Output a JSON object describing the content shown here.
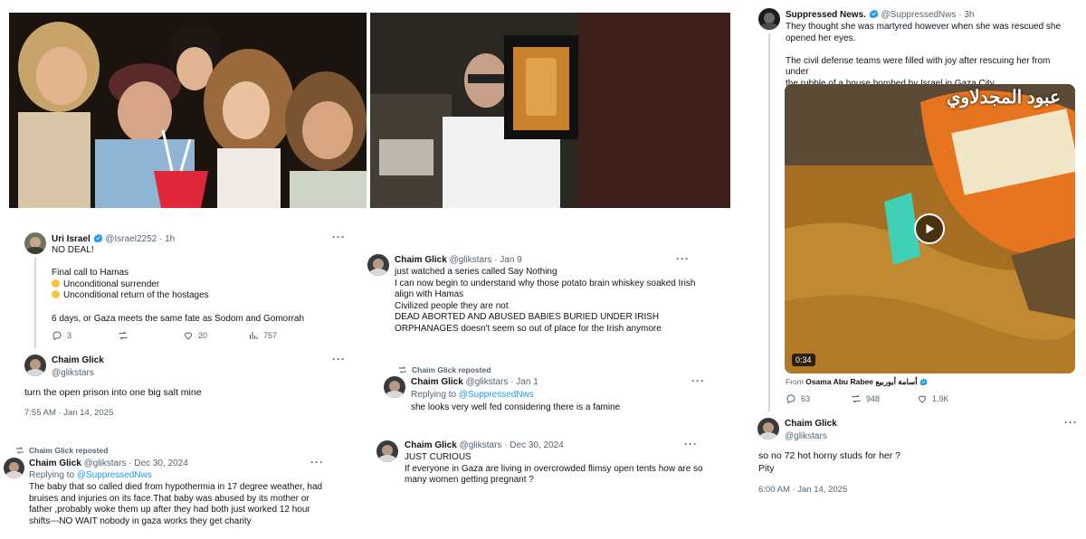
{
  "tweet_uri": {
    "name": "Uri Israel",
    "handle": "@Israel2252",
    "time": "· 1h",
    "line1": "NO DEAL!",
    "line2": "Final call to Hamas",
    "bullet1": "Unconditional surrender",
    "bullet2": "Unconditional return of the hostages",
    "line3": "6 days, or Gaza meets the same fate as Sodom and Gomorrah",
    "replies": "3",
    "likes": "20",
    "views": "757"
  },
  "reply_left": {
    "name": "Chaim Glick",
    "handle": "@glikstars",
    "text": "turn the open prison into one big salt mine",
    "timestamp": "7:55 AM · Jan 14, 2025"
  },
  "repost_left": {
    "reposted_label": "Chaim Glick reposted",
    "name": "Chaim Glick",
    "handle": "@glikstars",
    "time": "· Dec 30, 2024",
    "replying_prefix": "Replying to ",
    "replying_to": "@SuppressedNws",
    "text_lines": [
      "The baby that so called died from hypothermia in 17 degree weather, had",
      "bruises and injuries on its face.That baby was abused by its mother or",
      "father ,probably woke them up after they had both just worked 12 hour",
      "shifts---NO WAIT nobody in gaza works they get charity"
    ]
  },
  "tweet_mid1": {
    "name": "Chaim Glick",
    "handle": "@glikstars",
    "time": "· Jan 9",
    "text_lines": [
      "just watched a series called Say Nothing",
      "I can now begin to understand why those potato brain whiskey soaked Irish",
      "align with Hamas",
      "Civilized people they are not",
      "DEAD ABORTED AND ABUSED BABIES BURIED UNDER IRISH",
      "ORPHANAGES doesn't seem so out of place for the Irish anymore"
    ]
  },
  "repost_mid": {
    "reposted_label": "Chaim Glick reposted",
    "name": "Chaim Glick",
    "handle": "@glikstars",
    "time": "· Jan 1",
    "replying_prefix": "Replying to ",
    "replying_to": "@SuppressedNws",
    "text": "she looks very well fed considering there is a famine"
  },
  "tweet_mid2": {
    "name": "Chaim Glick",
    "handle": "@glikstars",
    "time": "· Dec 30, 2024",
    "text_lines": [
      "JUST CURIOUS",
      "If everyone in Gaza are living in overcrowded flimsy open tents how are so",
      "many women getting pregnant ?"
    ]
  },
  "tweet_suppressed": {
    "name": "Suppressed News.",
    "handle": "@SuppressedNws",
    "time": "· 3h",
    "text_lines": [
      "They thought she was martyred however when she was rescued she",
      "opened her eyes.",
      "",
      "The civil defense teams were filled with joy after rescuing her from under",
      "the rubble of a house bombed by Israel in Gaza City."
    ],
    "video_overlay_text": "عبود المجدلاوي",
    "duration": "0:34",
    "from_prefix": "From ",
    "from_name": "Osama Abu Rabee أسامة أبوربيع",
    "replies": "63",
    "reposts": "948",
    "likes": "1.9K"
  },
  "reply_right": {
    "name": "Chaim Glick",
    "handle": "@glikstars",
    "text_line1": "so no 72 hot horny studs for her ?",
    "text_line2": "Pity",
    "timestamp": "6:00 AM · Jan 14, 2025"
  },
  "colors": {
    "accent": "#1d9bf0",
    "muted": "#536471",
    "text": "#0f1419"
  }
}
